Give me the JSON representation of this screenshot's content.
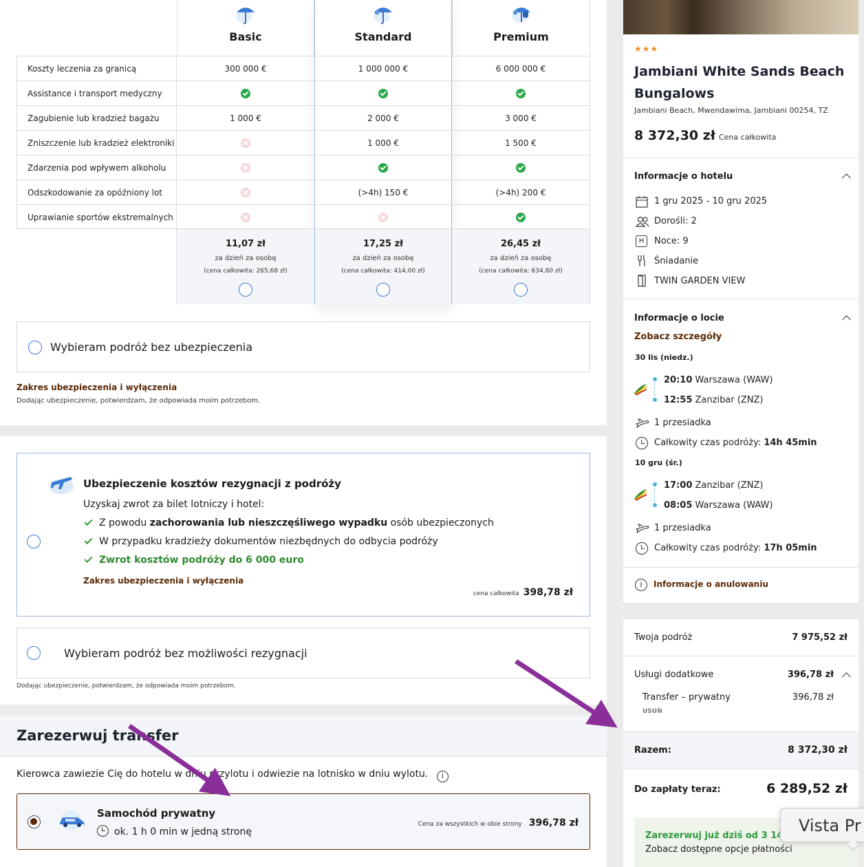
{
  "insurance_table": {
    "plans": [
      {
        "name": "Basic",
        "price": "11,07 zł",
        "per_day": "za dzień za osobę",
        "total": "(cena całkowita: 265,68 zł)"
      },
      {
        "name": "Standard",
        "price": "17,25 zł",
        "per_day": "za dzień za osobę",
        "total": "(cena całkowita: 414,00 zł)"
      },
      {
        "name": "Premium",
        "price": "26,45 zł",
        "per_day": "za dzień za osobę",
        "total": "(cena całkowita: 634,80 zł)"
      }
    ],
    "rows": [
      {
        "label": "Koszty leczenia za granicą",
        "values": [
          "300 000 €",
          "1 000 000 €",
          "6 000 000 €"
        ]
      },
      {
        "label": "Assistance i transport medyczny",
        "values": [
          "yes",
          "yes",
          "yes"
        ]
      },
      {
        "label": "Zagubienie lub kradzież bagażu",
        "values": [
          "1 000 €",
          "2 000 €",
          "3 000 €"
        ]
      },
      {
        "label": "Zniszczenie lub kradzież elektroniki",
        "values": [
          "no",
          "1 000 €",
          "1 500 €"
        ]
      },
      {
        "label": "Zdarzenia pod wpływem alkoholu",
        "values": [
          "no",
          "yes",
          "yes"
        ]
      },
      {
        "label": "Odszkodowanie za opóźniony lot",
        "values": [
          "no",
          "(>4h) 150 €",
          "(>4h) 200 €"
        ]
      },
      {
        "label": "Uprawianie sportów ekstremalnych",
        "values": [
          "no",
          "no",
          "yes"
        ]
      }
    ],
    "no_insurance_label": "Wybieram podróż bez ubezpieczenia",
    "scope_link": "Zakres ubezpieczenia i wyłączenia",
    "disclaimer": "Dodając ubezpieczenie, potwierdzam, że odpowiada moim potrzebom."
  },
  "cancellation": {
    "title": "Ubezpieczenie kosztów rezygnacji z podróży",
    "subtitle": "Uzyskaj zwrot za bilet lotniczy i hotel:",
    "bullet1_pre": "Z powodu ",
    "bullet1_bold": "zachorowania lub nieszczęśliwego wypadku",
    "bullet1_post": " osób ubezpieczonych",
    "bullet2": "W przypadku kradzieży dokumentów niezbędnych do odbycia podróży",
    "bullet3": "Zwrot kosztów podróży do 6 000 euro",
    "scope_link": "Zakres ubezpieczenia i wyłączenia",
    "price_label": "cena całkowita",
    "price": "398,78 zł",
    "no_option_label": "Wybieram podróż bez możliwości rezygnacji",
    "disclaimer": "Dodając ubezpieczenie, potwierdzam, że odpowiada moim potrzebom."
  },
  "transfer": {
    "heading": "Zarezerwuj transfer",
    "description": "Kierowca zawiezie Cię do hotelu w dniu przylotu i odwiezie na lotnisko w dniu wylotu.",
    "option_title": "Samochód prywatny",
    "option_duration": "ok. 1 h 0 min w jedną stronę",
    "price_label": "Cena za wszystkich w obie strony",
    "price": "396,78 zł"
  },
  "hotel": {
    "stars": "★★★",
    "name": "Jambiani White Sands Beach Bungalows",
    "address": "Jambiani Beach, Mwendawima, Jambiani 00254, TZ",
    "price": "8 372,30 zł",
    "price_label": "Cena całkowita",
    "info_heading": "Informacje o hotelu",
    "dates": "1 gru 2025 - 10 gru 2025",
    "adults": "Dorośli: 2",
    "nights": "Noce: 9",
    "board": "Śniadanie",
    "room": "TWIN GARDEN VIEW"
  },
  "flight": {
    "heading": "Informacje o locie",
    "details_link": "Zobacz szczegóły",
    "outbound": {
      "date": "30 lis (niedz.)",
      "dep_time": "20:10",
      "dep_place": "Warszawa (WAW)",
      "arr_time": "12:55",
      "arr_place": "Zanzibar (ZNZ)",
      "stops": "1 przesiadka",
      "duration_label": "Całkowity czas podróży: ",
      "duration": "14h 45min"
    },
    "inbound": {
      "date": "10 gru (śr.)",
      "dep_time": "17:00",
      "dep_place": "Zanzibar (ZNZ)",
      "arr_time": "08:05",
      "arr_place": "Warszawa (WAW)",
      "stops": "1 przesiadka",
      "duration_label": "Całkowity czas podróży: ",
      "duration": "17h 05min"
    },
    "cancel_info": "Informacje o anulowaniu"
  },
  "summary": {
    "trip_label": "Twoja podróż",
    "trip_value": "7 975,52 zł",
    "extras_label": "Usługi dodatkowe",
    "extras_value": "396,78 zł",
    "transfer_label": "Transfer – prywatny",
    "transfer_value": "396,78 zł",
    "remove": "USUŃ",
    "total_label": "Razem:",
    "total_value": "8 372,30 zł",
    "pay_now_label": "Do zapłaty teraz:",
    "pay_now_value": "6 289,52 zł",
    "promo_title": "Zarezerwuj już dziś od 3 145",
    "promo_sub": "Zobacz dostępne opcje płatności"
  },
  "tooltip": {
    "text": "Vista Pr"
  },
  "colors": {
    "accent_blue": "#3a7bd5",
    "brown_link": "#5a2a07",
    "green": "#2e9a3e",
    "arrow": "#8a2f9a"
  }
}
